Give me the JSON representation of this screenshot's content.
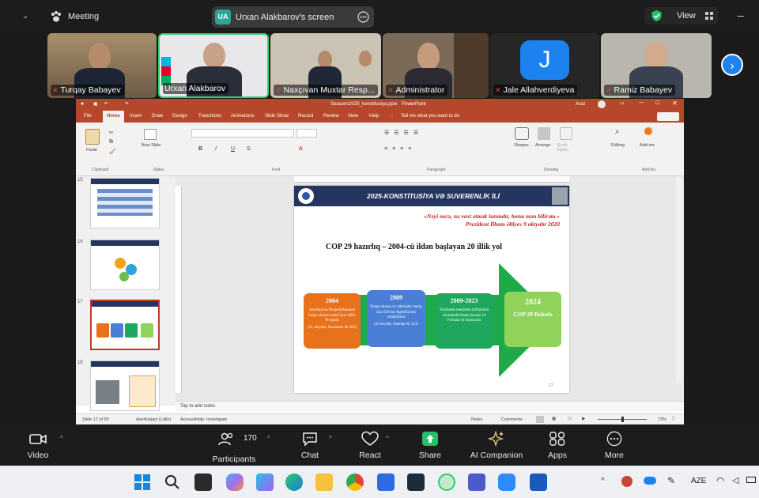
{
  "meeting": {
    "title": "Meeting",
    "share_initials": "UA",
    "share_label": "Urxan Alakbarov's screen",
    "view_label": "View"
  },
  "participants": [
    {
      "name": "Turqay Babayev"
    },
    {
      "name": "Urxan Alakbarov"
    },
    {
      "name": "Naxçıvan Muxtar Resp..."
    },
    {
      "name": "Administrator"
    },
    {
      "name": "Jale Allahverdiyeva",
      "avatar_letter": "J"
    },
    {
      "name": "Ramiz Babayev"
    }
  ],
  "ppt": {
    "title": "Seasons2025_konstitusiya.pptx",
    "app": "PowerPoint",
    "user": "Araz",
    "tabs": [
      "File",
      "Home",
      "Insert",
      "Draw",
      "Design",
      "Transitions",
      "Animations",
      "Slide Show",
      "Record",
      "Review",
      "View",
      "Help"
    ],
    "tell_me": "Tell me what you want to do",
    "ribbon": {
      "paste": "Paste",
      "new_slide": "New Slide",
      "clipboard": "Clipboard",
      "slides": "Slides",
      "font": "Font",
      "paragraph": "Paragraph",
      "drawing": "Drawing",
      "shapes": "Shapes",
      "arrange": "Arrange",
      "quick_styles": "Quick Styles",
      "editing": "Editing",
      "addins": "Add-ins"
    },
    "thumbnails": [
      {
        "num": "15"
      },
      {
        "num": "16"
      },
      {
        "num": "17"
      },
      {
        "num": "18"
      }
    ],
    "slide": {
      "banner": "2025-KONSTİTUSİYA VƏ SUVERENLİK İLİ",
      "quote": "«Nəyi necə, nə vaxt etmək lazımdır, bunu mən bilirəm.»",
      "quote_author": "Prezident İlham Əliyev 9 oktyabr 2020",
      "heading": "COP 29 hazırlıq – 2004-cü ildən başlayan 20 illik yol",
      "page_num": "17",
      "steps": [
        {
          "year": "2004",
          "text": "Azərbaycan Respublikasında bərpa olunan enerji üzrə Milli Proqram",
          "ref": "(21 oktyabr, Sərəncam № 462)",
          "color": "#e8711c"
        },
        {
          "year": "2009",
          "text": "Bərpa olunan və alternativ enerji üzrə Dövlət Agentliyinin yaradılması",
          "ref": "(10 noyabr, Fərman № 123)",
          "color": "#4a7fd6"
        },
        {
          "year": "2009-2023",
          "text": "Yenilənən enerjidən istifadənin sürətləndirilməsi barədə 14 Fərman və Sərəncam",
          "ref": "",
          "color": "#1fa85d"
        },
        {
          "year": "2024",
          "text": "COP 29 Bakıda",
          "ref": "",
          "color": "#8fd35a"
        }
      ]
    },
    "notes_placeholder": "Tap to add notes",
    "status": {
      "slide_info": "Slide 17 of 50",
      "language": "Azerbaijani (Latin)",
      "accessibility": "Accessibility: Investigate",
      "notes": "Notes",
      "comments": "Comments",
      "zoom": "73%"
    }
  },
  "controls": [
    {
      "label": "Video"
    },
    {
      "label": "Participants",
      "count": "170"
    },
    {
      "label": "Chat"
    },
    {
      "label": "React"
    },
    {
      "label": "Share"
    },
    {
      "label": "AI Companion"
    },
    {
      "label": "Apps"
    },
    {
      "label": "More"
    }
  ],
  "taskbar": {
    "language": "AZE"
  },
  "colors": {
    "ppt_accent": "#b7472a",
    "share_green": "#23c16b",
    "zoom_bar": "#1c1c1c"
  }
}
